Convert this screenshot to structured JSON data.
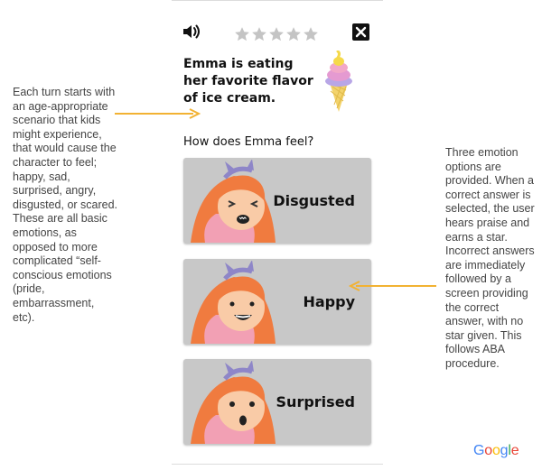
{
  "toolbar": {
    "speaker_icon": "speaker-icon",
    "stars_earned": 0,
    "stars_total": 5,
    "close_icon": "close-icon"
  },
  "scenario": {
    "text": "Emma is eating her favorite flavor of ice cream.",
    "image_icon": "ice-cream-cone-icon"
  },
  "question": "How does Emma feel?",
  "options": [
    {
      "label": "Disgusted"
    },
    {
      "label": "Happy"
    },
    {
      "label": "Surprised"
    }
  ],
  "annotations": {
    "left": "Each turn starts with an age-appropriate scenario that kids might experience, that would cause the character to feel; happy, sad, surprised, angry, disgusted, or scared. These are all basic emotions, as opposed to more complicated “self-conscious emotions (pride, embarrassment, etc).",
    "right": "Three emotion options are provided. When a correct answer is selected, the user hears praise and earns a star. Incorrect answers are immediately followed by a screen providing the correct answer, with no star given. This follows ABA procedure."
  },
  "watermark": "Google",
  "colors": {
    "arrow": "#f2b233",
    "card": "#c8c8c8",
    "star_empty": "#c4c4c4",
    "hair": "#f07b3f",
    "skin": "#f9cba7"
  }
}
